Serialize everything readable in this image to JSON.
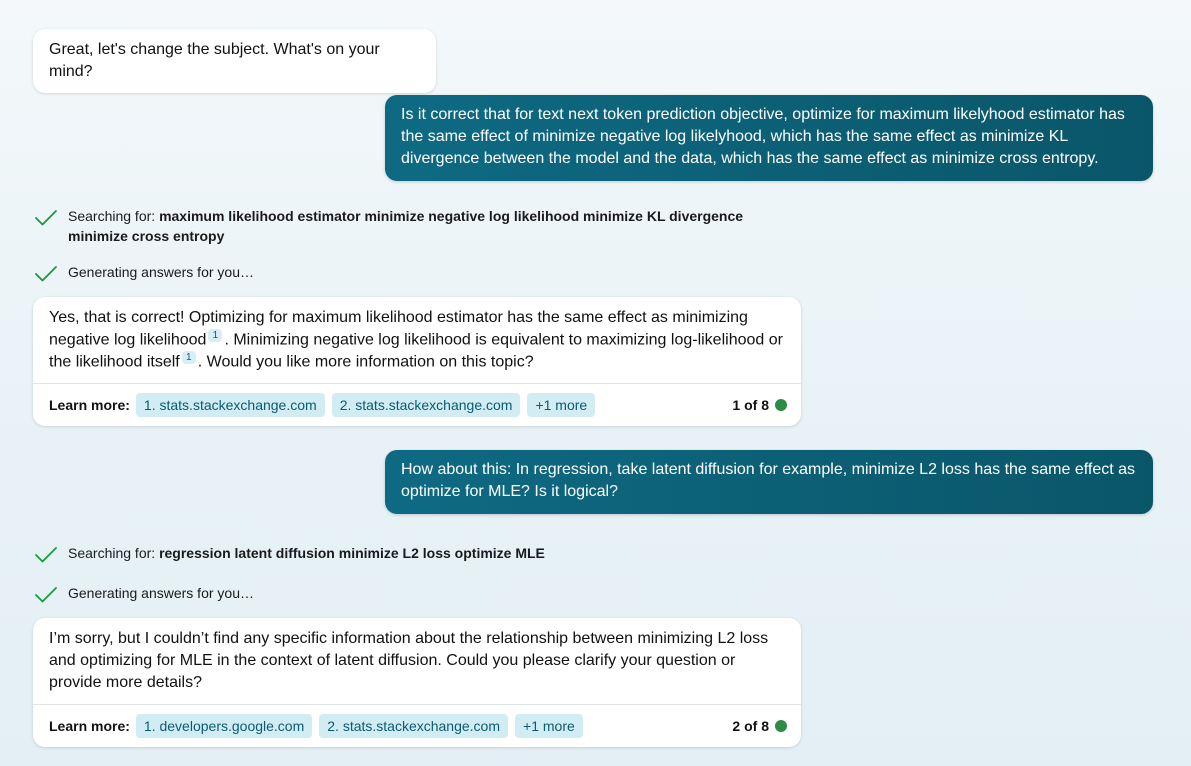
{
  "colors": {
    "user_bubble": "#0b5e74",
    "chip_bg": "#d2ecf3",
    "chip_text": "#0b5b72",
    "check_green": "#1a9a3a",
    "status_dot": "#2e8b47"
  },
  "messages": {
    "greeting": "Great, let's change the subject. What's on your mind?",
    "user_q1": "Is it correct that for text next token prediction objective, optimize for maximum likelyhood estimator has the same effect of minimize negative log likelyhood, which has the same effect as minimize KL divergence between the model and the data, which has the same effect as minimize cross entropy.",
    "search1": {
      "prefix": "Searching for: ",
      "query": "maximum likelihood estimator minimize negative log likelihood minimize KL divergence minimize cross entropy",
      "check_icon": "checkmark-icon"
    },
    "generating1": {
      "text": "Generating answers for you…",
      "check_icon": "checkmark-icon"
    },
    "answer1": {
      "part1": "Yes, that is correct! Optimizing for maximum likelihood estimator has the same effect as minimizing negative log likelihood",
      "ref1": "1",
      "part2": ". Minimizing negative log likelihood is equivalent to maximizing log-likelihood or the likelihood itself",
      "ref2": "1",
      "part3": ". Would you like more information on this topic?",
      "learn_label": "Learn more:",
      "links": [
        "1. stats.stackexchange.com",
        "2. stats.stackexchange.com",
        "+1 more"
      ],
      "pager": "1 of 8"
    },
    "user_q2": "How about this: In regression, take latent diffusion for example, minimize L2 loss has the same effect as optimize for MLE? Is it logical?",
    "search2": {
      "prefix": "Searching for: ",
      "query": "regression latent diffusion minimize L2 loss optimize MLE",
      "check_icon": "checkmark-icon"
    },
    "generating2": {
      "text": "Generating answers for you…",
      "check_icon": "checkmark-icon"
    },
    "answer2": {
      "text": "I’m sorry, but I couldn’t find any specific information about the relationship between minimizing L2 loss and optimizing for MLE in the context of latent diffusion. Could you please clarify your question or provide more details?",
      "learn_label": "Learn more:",
      "links": [
        "1. developers.google.com",
        "2. stats.stackexchange.com",
        "+1 more"
      ],
      "pager": "2 of 8"
    }
  }
}
